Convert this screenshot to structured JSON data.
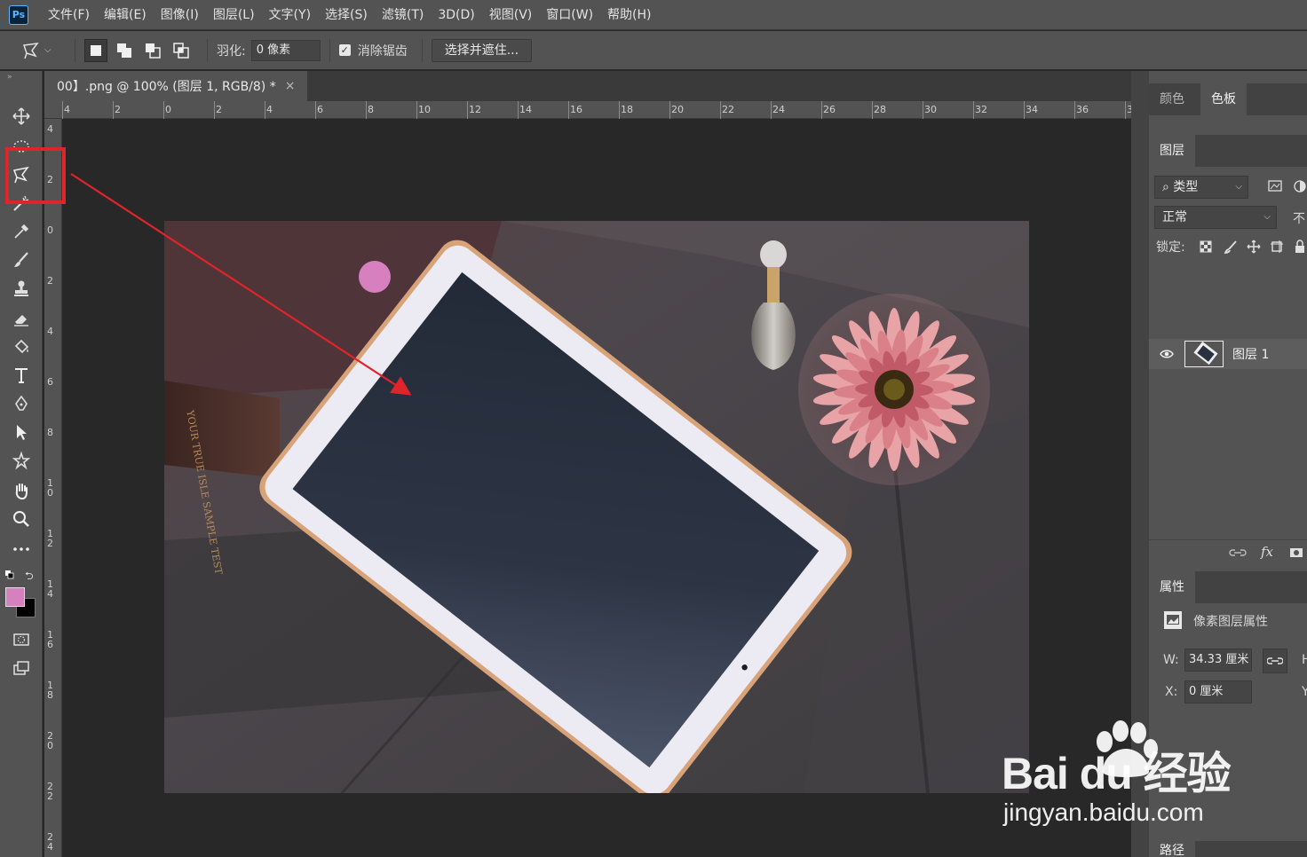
{
  "app": {
    "logo_text": "Ps"
  },
  "menu": [
    "文件(F)",
    "编辑(E)",
    "图像(I)",
    "图层(L)",
    "文字(Y)",
    "选择(S)",
    "滤镜(T)",
    "3D(D)",
    "视图(V)",
    "窗口(W)",
    "帮助(H)"
  ],
  "options": {
    "feather_label": "羽化:",
    "feather_value": "0 像素",
    "antialias_label": "消除锯齿",
    "antialias_checked": true,
    "select_mask_button": "选择并遮住..."
  },
  "document": {
    "tab_title": "00】.png @ 100% (图层 1, RGB/8) *",
    "close_glyph": "×",
    "ruler_top_labels": [
      "4",
      "2",
      "0",
      "2",
      "4",
      "6",
      "8",
      "10",
      "12",
      "14",
      "16",
      "18",
      "20",
      "22",
      "24",
      "26",
      "28",
      "30",
      "32",
      "34",
      "36",
      "3"
    ],
    "ruler_left_labels": [
      "4",
      "2",
      "0",
      "2",
      "4",
      "6",
      "8",
      "1 0",
      "1 2",
      "1 4",
      "1 6",
      "1 8",
      "2 0",
      "2 2",
      "2 4"
    ]
  },
  "colors": {
    "accent_red": "#e0242b",
    "foreground_color": "#d680c0",
    "background_color": "#000000",
    "pink_dot": "#d680c0"
  },
  "panels": {
    "color_tabs": [
      "颜色",
      "色板"
    ],
    "layers_tab": "图层",
    "filter_kind": "类型",
    "blend_mode": "正常",
    "opacity_label_partial": "不",
    "lock_label": "锁定:",
    "layer_name": "图层 1",
    "properties_tab": "属性",
    "properties_title": "像素图层属性",
    "w_label": "W:",
    "w_value": "34.33 厘米",
    "x_label": "X:",
    "x_value": "0 厘米",
    "h_label_partial": "H",
    "y_label_partial": "Y",
    "bottom_tab_partial": "路径"
  },
  "watermark": {
    "brand": "Bai du 经验",
    "url": "jingyan.baidu.com"
  },
  "book_text": "YOUR TRUE ISLE SAMPLE TEST"
}
